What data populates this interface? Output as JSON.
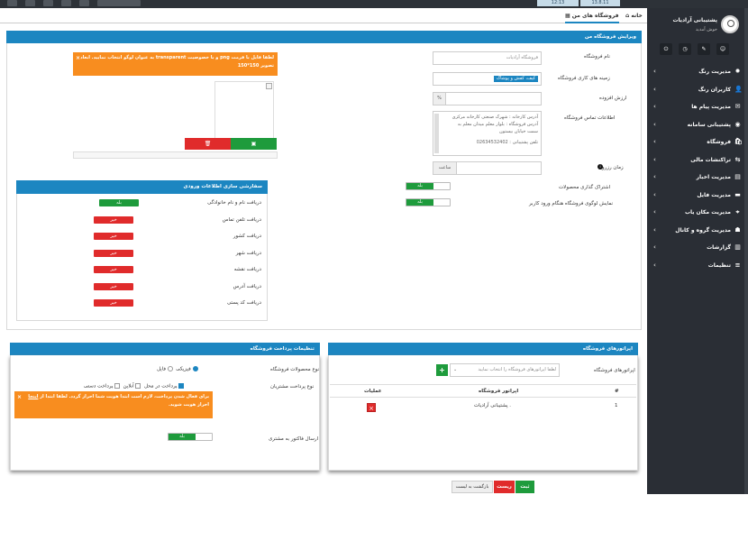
{
  "topbar": {
    "time": "12:13",
    "date": "13.8.11"
  },
  "sidebar": {
    "user_name": "پشتیبانی آرادیات",
    "user_status": "خوش آمدید",
    "items": [
      {
        "label": "مدیریت رنگ",
        "icon": "✹"
      },
      {
        "label": "کاربران رنگ",
        "icon": "👤"
      },
      {
        "label": "مدیریت پیام ها",
        "icon": "✉"
      },
      {
        "label": "پشتیبانی سامانه",
        "icon": "◉"
      },
      {
        "label": "فروشگاه",
        "icon": "🛍"
      },
      {
        "label": "تراکنشات مالی",
        "icon": "⇆"
      },
      {
        "label": "مدیریت اخبار",
        "icon": "▤"
      },
      {
        "label": "مدیریت فایل",
        "icon": "▬"
      },
      {
        "label": "مدیریت مکان یاب",
        "icon": "⌖"
      },
      {
        "label": "مدیریت گروه و کانال",
        "icon": "☗"
      },
      {
        "label": "گزارشات",
        "icon": "▥"
      },
      {
        "label": "تنظیمات",
        "icon": "≡"
      }
    ]
  },
  "tabs": {
    "home": "خانه",
    "store": "فروشگاه های من"
  },
  "edit_panel": {
    "title": "ویرایش فروشگاه من",
    "store_name_label": "نام فروشگاه",
    "store_name_value": "فروشگاه آرادیات",
    "business_label": "زمینه های کاری فروشگاه",
    "business_tag": "کیف، کفش و پوشاک",
    "vat_label": "ارزش افزوده",
    "vat_symbol": "%",
    "contact_label": "اطلاعات تماس فروشگاه",
    "contact_line1": "آدرس کارخانه : شهرک صنعتی کارخانه مرکزی",
    "contact_line2": "آدرس فروشگاه : بلوار معلم میدان معلم به",
    "contact_line3": "سمت خیابان بیستون",
    "contact_line4": "تلفن پشتیبانی : 02634532402",
    "ready_label": "زمان رزرو",
    "ready_unit": "ساعت",
    "share_label": "اشتراک گذاری محصولات",
    "logo_label": "نمایش لوگوی فروشگاه هنگام ورود کاربر",
    "toggle_on": "بله",
    "alert": "لطفا فایل با فرمت png و با خصوصیت transparent به عنوان لوگو انتخاب نمایید. ابعاد تصویر 150*150"
  },
  "order_panel": {
    "title": "سفارشی سازی اطلاعات ورودی",
    "rows": [
      {
        "label": "دریافت نام و نام خانوادگی",
        "state": "بله",
        "on": true
      },
      {
        "label": "دریافت تلفن تماس",
        "state": "خیر",
        "on": false
      },
      {
        "label": "دریافت کشور",
        "state": "خیر",
        "on": false
      },
      {
        "label": "دریافت شهر",
        "state": "خیر",
        "on": false
      },
      {
        "label": "دریافت نقشه",
        "state": "خیر",
        "on": false
      },
      {
        "label": "دریافت آدرس",
        "state": "خیر",
        "on": false
      },
      {
        "label": "دریافت کد پستی",
        "state": "خیر",
        "on": false
      }
    ]
  },
  "operators_panel": {
    "title": "اپراتورهای فروشگاه",
    "select_label": "اپراتورهای فروشگاه",
    "select_placeholder": "لطفا اپراتورهای فروشگاه را انتخاب نمایید",
    "col_num": "#",
    "col_operator": "اپراتور فروشگاه",
    "col_actions": "عملیات",
    "rows": [
      {
        "num": "1",
        "name": "پشتیبانی آرادیات ."
      }
    ]
  },
  "payment_panel": {
    "title": "تنظیمات پرداخت فروشگاه",
    "product_type_label": "نوع محصولات فروشگاه",
    "opt_physical": "فیزیکی",
    "opt_digital": "فایل",
    "pay_type_label": "نوع پرداخت مشتریان",
    "opt_cod": "پرداخت در محل",
    "opt_online": "آنلاین",
    "opt_manual": "پرداخت دستی",
    "alert": "برای فعال شدن پرداخت، لازم است ابتدا هویت شما احراز گردد. لطفا ابتدا از",
    "alert_link": "اینجا",
    "alert_tail": "احراز هویت شوید.",
    "invoice_label": "ارسال فاکتور به مشتری",
    "toggle_on": "بله"
  },
  "footer": {
    "save": "ثبت",
    "reset": "ریست",
    "back": "بازگشت به لیست"
  }
}
